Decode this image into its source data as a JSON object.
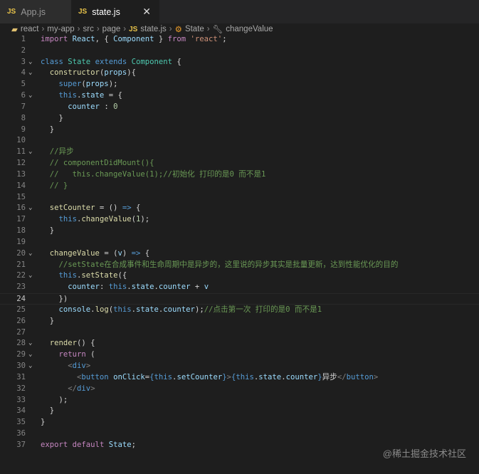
{
  "tabs": [
    {
      "label": "App.js",
      "icon": "JS"
    },
    {
      "label": "state.js",
      "icon": "JS",
      "close": "✕"
    }
  ],
  "breadcrumb": [
    "react",
    "my-app",
    "src",
    "page",
    "state.js",
    "State",
    "changeValue"
  ],
  "breadcrumb_icon": "JS",
  "current_line": 24,
  "folds": [
    3,
    4,
    6,
    11,
    16,
    20,
    22,
    28,
    29,
    30
  ],
  "lines": [
    [
      [
        "kw",
        "import"
      ],
      [
        "tx",
        " "
      ],
      [
        "va",
        "React"
      ],
      [
        "tx",
        ", { "
      ],
      [
        "va",
        "Component"
      ],
      [
        "tx",
        " } "
      ],
      [
        "kw",
        "from"
      ],
      [
        "tx",
        " "
      ],
      [
        "st",
        "'react'"
      ],
      [
        "tx",
        ";"
      ]
    ],
    [],
    [
      [
        "bl",
        "class"
      ],
      [
        "tx",
        " "
      ],
      [
        "ty",
        "State"
      ],
      [
        "tx",
        " "
      ],
      [
        "bl",
        "extends"
      ],
      [
        "tx",
        " "
      ],
      [
        "ty",
        "Component"
      ],
      [
        "tx",
        " {"
      ]
    ],
    [
      [
        "tx",
        "  "
      ],
      [
        "fn",
        "constructor"
      ],
      [
        "tx",
        "("
      ],
      [
        "va",
        "props"
      ],
      [
        "tx",
        "){"
      ]
    ],
    [
      [
        "tx",
        "    "
      ],
      [
        "bl",
        "super"
      ],
      [
        "tx",
        "("
      ],
      [
        "va",
        "props"
      ],
      [
        "tx",
        ");"
      ]
    ],
    [
      [
        "tx",
        "    "
      ],
      [
        "bl",
        "this"
      ],
      [
        "tx",
        "."
      ],
      [
        "va",
        "state"
      ],
      [
        "tx",
        " = {"
      ]
    ],
    [
      [
        "tx",
        "      "
      ],
      [
        "va",
        "counter"
      ],
      [
        "tx",
        " : "
      ],
      [
        "nu",
        "0"
      ]
    ],
    [
      [
        "tx",
        "    }"
      ]
    ],
    [
      [
        "tx",
        "  }"
      ]
    ],
    [],
    [
      [
        "tx",
        "  "
      ],
      [
        "cm",
        "//异步"
      ]
    ],
    [
      [
        "tx",
        "  "
      ],
      [
        "cm",
        "// componentDidMount(){"
      ]
    ],
    [
      [
        "tx",
        "  "
      ],
      [
        "cm",
        "//   this.changeValue(1);//初始化 打印的是0 而不是1"
      ]
    ],
    [
      [
        "tx",
        "  "
      ],
      [
        "cm",
        "// }"
      ]
    ],
    [],
    [
      [
        "tx",
        "  "
      ],
      [
        "fn",
        "setCounter"
      ],
      [
        "tx",
        " = () "
      ],
      [
        "bl",
        "=>"
      ],
      [
        "tx",
        " {"
      ]
    ],
    [
      [
        "tx",
        "    "
      ],
      [
        "bl",
        "this"
      ],
      [
        "tx",
        "."
      ],
      [
        "fn",
        "changeValue"
      ],
      [
        "tx",
        "("
      ],
      [
        "nu",
        "1"
      ],
      [
        "tx",
        ");"
      ]
    ],
    [
      [
        "tx",
        "  }"
      ]
    ],
    [],
    [
      [
        "tx",
        "  "
      ],
      [
        "fn",
        "changeValue"
      ],
      [
        "tx",
        " = ("
      ],
      [
        "va",
        "v"
      ],
      [
        "tx",
        ") "
      ],
      [
        "bl",
        "=>"
      ],
      [
        "tx",
        " {"
      ]
    ],
    [
      [
        "tx",
        "    "
      ],
      [
        "cm",
        "//setState在合成事件和生命周期中是异步的，这里说的异步其实是批量更新，达到性能优化的目的"
      ]
    ],
    [
      [
        "tx",
        "    "
      ],
      [
        "bl",
        "this"
      ],
      [
        "tx",
        "."
      ],
      [
        "fn",
        "setState"
      ],
      [
        "tx",
        "({"
      ]
    ],
    [
      [
        "tx",
        "      "
      ],
      [
        "va",
        "counter"
      ],
      [
        "tx",
        ": "
      ],
      [
        "bl",
        "this"
      ],
      [
        "tx",
        "."
      ],
      [
        "va",
        "state"
      ],
      [
        "tx",
        "."
      ],
      [
        "va",
        "counter"
      ],
      [
        "tx",
        " + "
      ],
      [
        "va",
        "v"
      ]
    ],
    [
      [
        "tx",
        "    })"
      ]
    ],
    [
      [
        "tx",
        "    "
      ],
      [
        "va",
        "console"
      ],
      [
        "tx",
        "."
      ],
      [
        "fn",
        "log"
      ],
      [
        "tx",
        "("
      ],
      [
        "bl",
        "this"
      ],
      [
        "tx",
        "."
      ],
      [
        "va",
        "state"
      ],
      [
        "tx",
        "."
      ],
      [
        "va",
        "counter"
      ],
      [
        "tx",
        ");"
      ],
      [
        "cm",
        "//点击第一次 打印的是0 而不是1"
      ]
    ],
    [
      [
        "tx",
        "  }"
      ]
    ],
    [],
    [
      [
        "tx",
        "  "
      ],
      [
        "fn",
        "render"
      ],
      [
        "tx",
        "() {"
      ]
    ],
    [
      [
        "tx",
        "    "
      ],
      [
        "kw",
        "return"
      ],
      [
        "tx",
        " ("
      ]
    ],
    [
      [
        "tx",
        "      "
      ],
      [
        "tg",
        "<"
      ],
      [
        "bl",
        "div"
      ],
      [
        "tg",
        ">"
      ]
    ],
    [
      [
        "tx",
        "        "
      ],
      [
        "tg",
        "<"
      ],
      [
        "bl",
        "button"
      ],
      [
        "tx",
        " "
      ],
      [
        "va",
        "onClick"
      ],
      [
        "tx",
        "="
      ],
      [
        "bl",
        "{"
      ],
      [
        "bl",
        "this"
      ],
      [
        "tx",
        "."
      ],
      [
        "va",
        "setCounter"
      ],
      [
        "bl",
        "}"
      ],
      [
        "tg",
        ">"
      ],
      [
        "bl",
        "{"
      ],
      [
        "bl",
        "this"
      ],
      [
        "tx",
        "."
      ],
      [
        "va",
        "state"
      ],
      [
        "tx",
        "."
      ],
      [
        "va",
        "counter"
      ],
      [
        "bl",
        "}"
      ],
      [
        "tx",
        "异步"
      ],
      [
        "tg",
        "</"
      ],
      [
        "bl",
        "button"
      ],
      [
        "tg",
        ">"
      ]
    ],
    [
      [
        "tx",
        "      "
      ],
      [
        "tg",
        "</"
      ],
      [
        "bl",
        "div"
      ],
      [
        "tg",
        ">"
      ]
    ],
    [
      [
        "tx",
        "    );"
      ]
    ],
    [
      [
        "tx",
        "  }"
      ]
    ],
    [
      [
        "tx",
        "}"
      ]
    ],
    [],
    [
      [
        "kw",
        "export"
      ],
      [
        "tx",
        " "
      ],
      [
        "kw",
        "default"
      ],
      [
        "tx",
        " "
      ],
      [
        "va",
        "State"
      ],
      [
        "tx",
        ";"
      ]
    ]
  ],
  "watermark": "@稀土掘金技术社区"
}
